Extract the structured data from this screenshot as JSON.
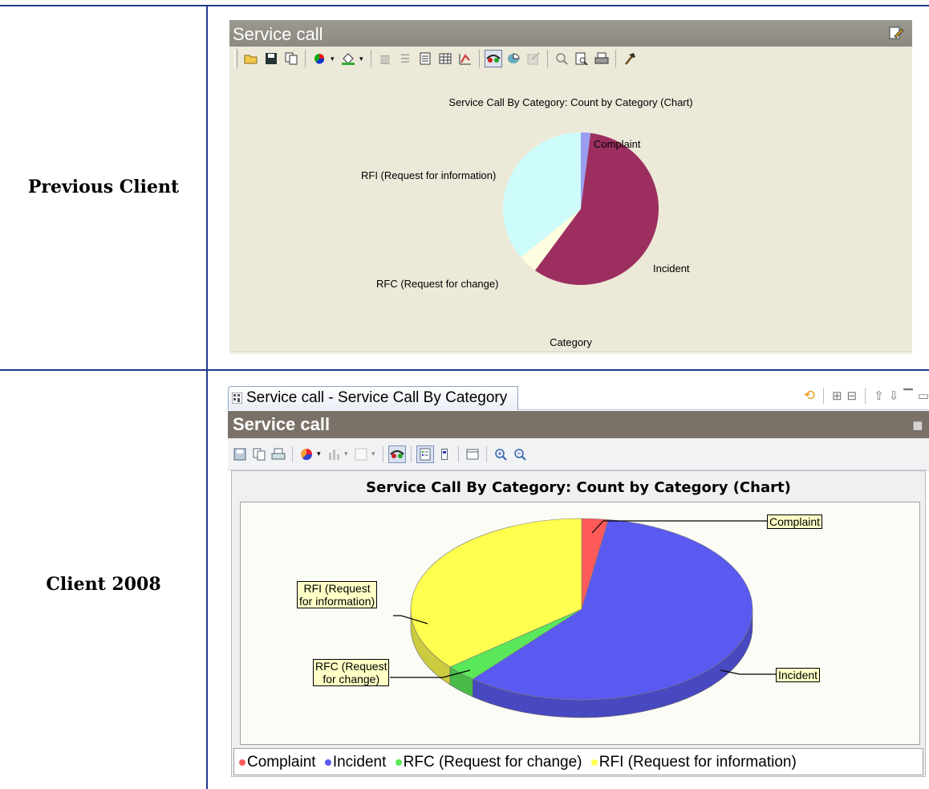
{
  "row_labels": {
    "previous": "Previous Client",
    "client2008": "Client 2008"
  },
  "previous_client": {
    "panel_title": "Service call",
    "chart_title": "Service Call By Category: Count by Category (Chart)",
    "xlabel": "Category",
    "slice_labels": {
      "complaint": "Complaint",
      "incident": "Incident",
      "rfc": "RFC (Request for change)",
      "rfi": "RFI (Request for information)"
    },
    "colors": {
      "complaint": "#9a9ef0",
      "incident": "#9c2f5f",
      "rfc": "#fffde0",
      "rfi": "#cdfcfb"
    },
    "toolbar_icons": [
      "open-icon",
      "save-icon",
      "copy-icon",
      "chart-type-icon",
      "fill-color-icon",
      "bar-columns-icon",
      "list-icon",
      "report-icon",
      "table-icon",
      "chart-wizard-icon",
      "3d-glasses-icon",
      "pie-3d-icon",
      "export-icon",
      "zoom-icon",
      "print-preview-icon",
      "print-icon",
      "hammer-icon"
    ]
  },
  "client2008": {
    "tab_label": "Service call - Service Call By Category",
    "panel_title": "Service call",
    "chart_title": "Service Call By Category: Count by Category (Chart)",
    "callouts": {
      "complaint": "Complaint",
      "incident": "Incident",
      "rfc_line1": "RFC (Request",
      "rfc_line2": "for change)",
      "rfi_line1": "RFI (Request",
      "rfi_line2": "for information)"
    },
    "legend": [
      {
        "label": "Complaint",
        "color": "#ff5a5a"
      },
      {
        "label": "Incident",
        "color": "#5a5af0"
      },
      {
        "label": "RFC (Request for change)",
        "color": "#5ae85a"
      },
      {
        "label": "RFI (Request for information)",
        "color": "#ffff50"
      }
    ],
    "toolbar_icons": [
      "save-icon",
      "copy-icon",
      "print-icon",
      "pie-chart-icon",
      "bar-chart-icon",
      "frame-icon",
      "3d-glasses-icon",
      "legend-icon",
      "data-label-icon",
      "table-icon",
      "zoom-in-icon",
      "zoom-out-icon"
    ]
  },
  "chart_data": [
    {
      "type": "pie",
      "title": "Service Call By Category: Count by Category (Chart)",
      "xlabel": "Category",
      "categories": [
        "Complaint",
        "Incident",
        "RFC (Request for change)",
        "RFI (Request for information)"
      ],
      "values": [
        2,
        58,
        4,
        36
      ],
      "legend": "none"
    },
    {
      "type": "pie",
      "title": "Service Call By Category: Count by Category (Chart)",
      "categories": [
        "Complaint",
        "Incident",
        "RFC (Request for change)",
        "RFI (Request for information)"
      ],
      "values": [
        2.5,
        58.5,
        3,
        36
      ],
      "legend": "bottom"
    }
  ]
}
